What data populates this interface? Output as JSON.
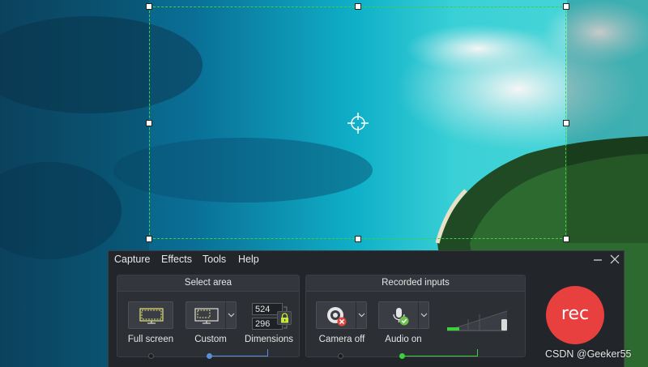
{
  "menu": {
    "capture": "Capture",
    "effects": "Effects",
    "tools": "Tools",
    "help": "Help"
  },
  "window_controls": {
    "minimize_icon": "minimize-icon",
    "close_icon": "close-icon"
  },
  "select_area": {
    "header": "Select area",
    "full_screen_label": "Full screen",
    "custom_label": "Custom",
    "dimensions_label": "Dimensions",
    "width": "524",
    "height": "296",
    "lock_icon": "lock-icon",
    "lock_color": "#c9e63a"
  },
  "recorded_inputs": {
    "header": "Recorded inputs",
    "camera_label": "Camera off",
    "audio_label": "Audio on",
    "camera_status_color": "#e0463e",
    "audio_status_color": "#6cc24a",
    "audio_level": 0.2
  },
  "record_button": {
    "label": "rec",
    "color": "#e8403e"
  },
  "watermark": "CSDN @Geeker55",
  "accent_green": "#3dd13d",
  "accent_blue": "#5b8fd6"
}
